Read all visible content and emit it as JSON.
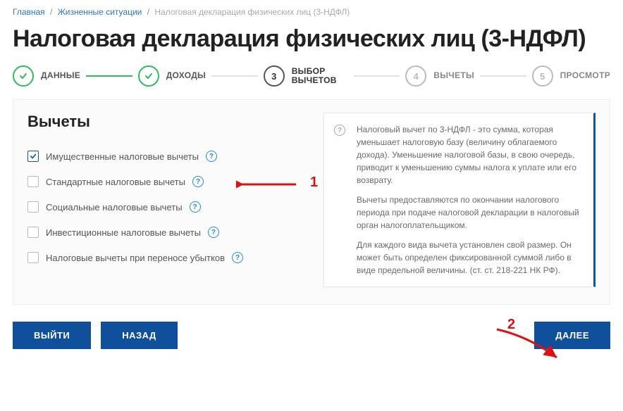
{
  "breadcrumb": {
    "home": "Главная",
    "situations": "Жизненные ситуации",
    "current": "Налоговая декларация физических лиц (3-НДФЛ)"
  },
  "title": "Налоговая декларация физических лиц (3-НДФЛ)",
  "steps": {
    "s1": "ДАННЫЕ",
    "s2": "ДОХОДЫ",
    "s3": "ВЫБОР ВЫЧЕТОВ",
    "s4": "ВЫЧЕТЫ",
    "s5": "ПРОСМОТР",
    "n3": "3",
    "n4": "4",
    "n5": "5"
  },
  "section_title": "Вычеты",
  "checks": {
    "c1": "Имущественные налоговые вычеты",
    "c2": "Стандартные налоговые вычеты",
    "c3": "Социальные налоговые вычеты",
    "c4": "Инвестиционные налоговые вычеты",
    "c5": "Налоговые вычеты при переносе убытков"
  },
  "info": {
    "p1": "Налоговый вычет по 3-НДФЛ - это сумма, которая уменьшает налоговую базу (величину облагаемого дохода). Уменьшение налоговой базы, в свою очередь, приводит к уменьшению суммы налога к уплате или его возврату.",
    "p2": "Вычеты предоставляются по окончании налогового периода при подаче налоговой декларации в налоговый орган налогоплательщиком.",
    "p3": "Для каждого вида вычета установлен свой размер. Он может быть определен фиксированной суммой либо в виде предельной величины. (ст. ст. 218-221 НК РФ)."
  },
  "buttons": {
    "exit": "ВЫЙТИ",
    "back": "НАЗАД",
    "next": "ДАЛЕЕ"
  },
  "annot": {
    "one": "1",
    "two": "2"
  },
  "qmark": "?"
}
